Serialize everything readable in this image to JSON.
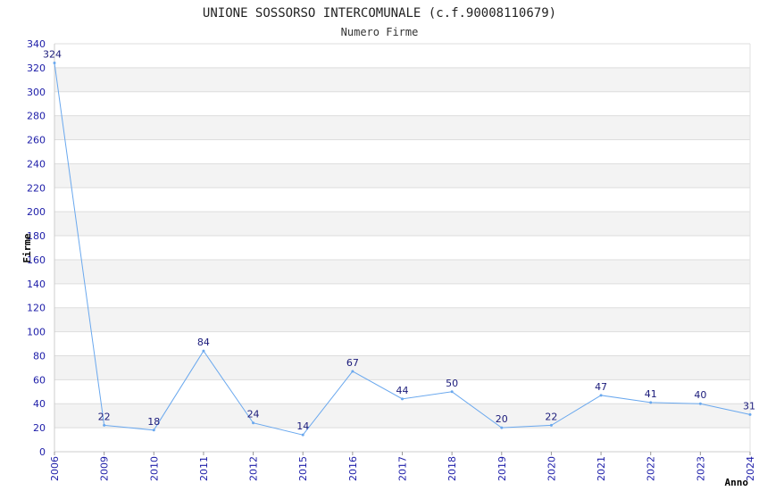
{
  "chart_data": {
    "type": "line",
    "title": "UNIONE SOSSORSO INTERCOMUNALE (c.f.90008110679)",
    "subtitle": "Numero Firme",
    "xlabel": "Anno",
    "ylabel": "Firme",
    "categories": [
      "2006",
      "2009",
      "2010",
      "2011",
      "2012",
      "2015",
      "2016",
      "2017",
      "2018",
      "2019",
      "2020",
      "2021",
      "2022",
      "2023",
      "2024"
    ],
    "series": [
      {
        "values": [
          324,
          22,
          18,
          84,
          24,
          14,
          67,
          44,
          50,
          20,
          22,
          47,
          41,
          40,
          31
        ]
      }
    ],
    "ylim": [
      0,
      340
    ],
    "yticks": [
      0,
      20,
      40,
      60,
      80,
      100,
      120,
      140,
      160,
      180,
      200,
      220,
      240,
      260,
      280,
      300,
      320,
      340
    ],
    "grid": true,
    "colors": {
      "line": "#6aa8ee",
      "band": "#f3f3f3",
      "grid": "#dddddd",
      "tick_text": "#1c1ca8"
    }
  }
}
